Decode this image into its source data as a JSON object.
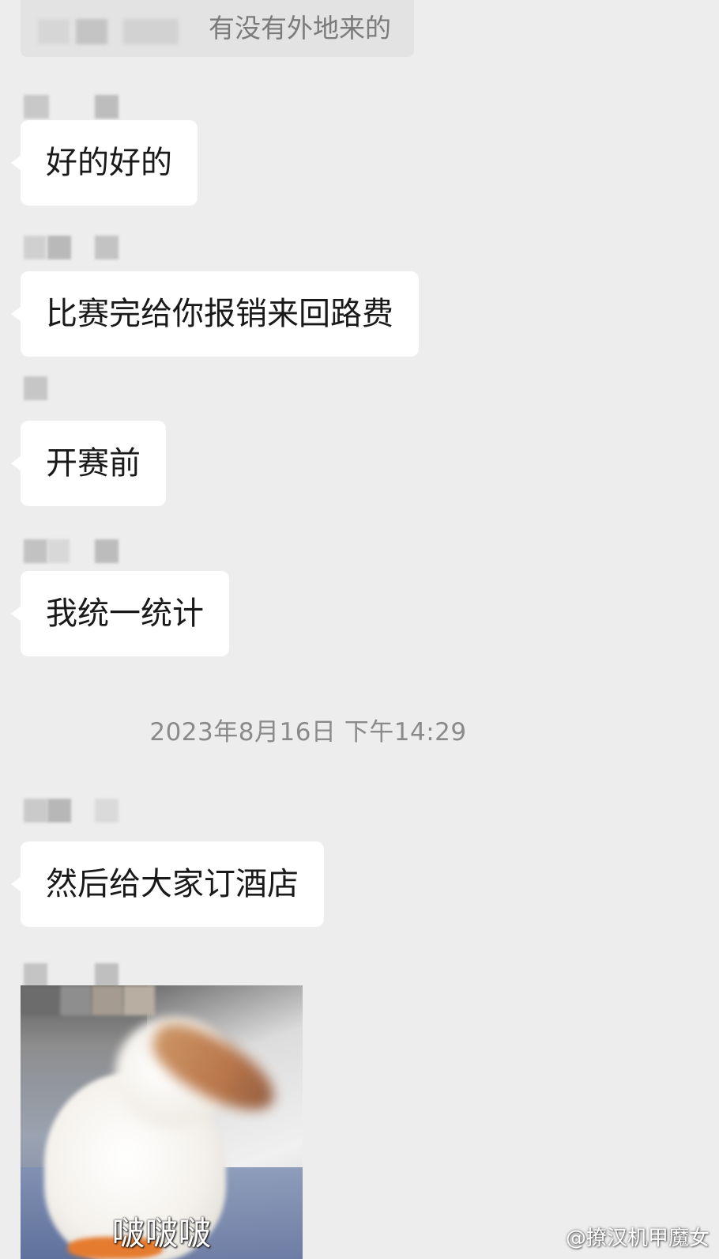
{
  "quoted_message": {
    "text": "有没有外地来的"
  },
  "messages": [
    {
      "text": "好的好的"
    },
    {
      "text": "比赛完给你报销来回路费"
    },
    {
      "text": "开赛前"
    },
    {
      "text": "我统一统计"
    },
    {
      "text": "然后给大家订酒店"
    }
  ],
  "timestamp": "2023年8月16日 下午14:29",
  "sticker": {
    "caption": "啵啵啵"
  },
  "watermark": "@撩汉机甲魔女",
  "colors": {
    "background": "#ededed",
    "bubble": "#ffffff",
    "text": "#191919",
    "timestamp": "#8a8a8a"
  }
}
